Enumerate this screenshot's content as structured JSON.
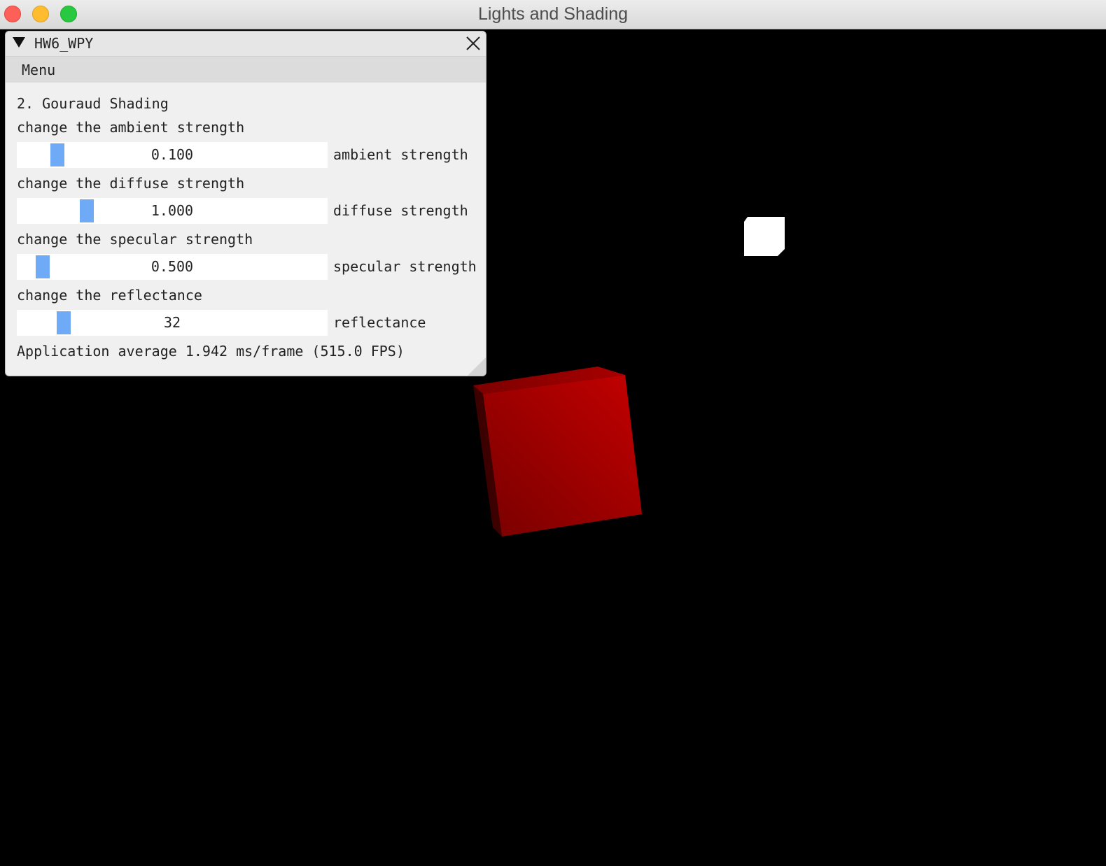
{
  "app": {
    "window_title": "Lights and Shading"
  },
  "panel": {
    "title": "HW6_WPY",
    "menu_label": "Menu",
    "section_title": "2. Gouraud Shading",
    "controls": [
      {
        "heading": "change the ambient strength",
        "value_text": "0.100",
        "label": "ambient strength",
        "fraction": 0.11
      },
      {
        "heading": "change the diffuse strength",
        "value_text": "1.000",
        "label": "diffuse strength",
        "fraction": 0.21
      },
      {
        "heading": "change the specular strength",
        "value_text": "0.500",
        "label": "specular strength",
        "fraction": 0.06
      },
      {
        "heading": "change the reflectance",
        "value_text": "32",
        "label": "reflectance",
        "fraction": 0.13
      }
    ],
    "fps_text": "Application average 1.942 ms/frame (515.0 FPS)"
  },
  "scene": {
    "cube_color": "#c00000",
    "light_color": "#ffffff",
    "background": "#000000"
  },
  "icons": {
    "collapse": "collapse-triangle-icon",
    "close": "close-icon"
  }
}
